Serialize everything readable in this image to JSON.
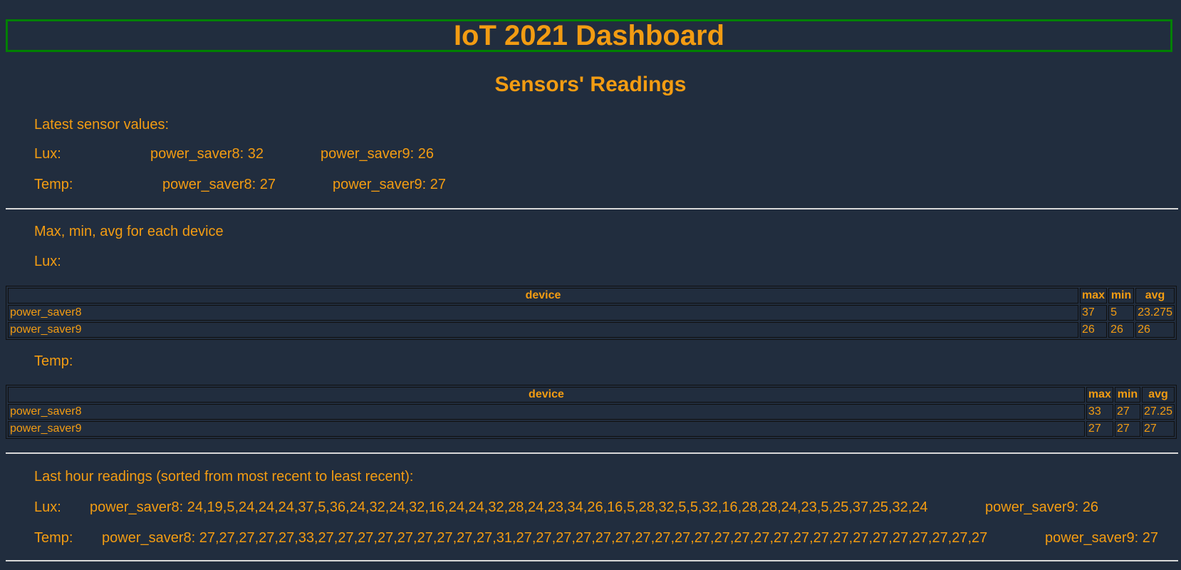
{
  "header": {
    "title": "IoT 2021 Dashboard",
    "subtitle": "Sensors' Readings"
  },
  "latest": {
    "heading": "Latest sensor values:",
    "lux": {
      "label": "Lux:",
      "values": [
        "power_saver8: 32",
        "power_saver9: 26"
      ]
    },
    "temp": {
      "label": "Temp:",
      "values": [
        "power_saver8: 27",
        "power_saver9: 27"
      ]
    }
  },
  "stats": {
    "heading": "Max, min, avg for each device",
    "lux": {
      "label": "Lux:",
      "columns": [
        "device",
        "max",
        "min",
        "avg"
      ],
      "rows": [
        [
          "power_saver8",
          "37",
          "5",
          "23.275"
        ],
        [
          "power_saver9",
          "26",
          "26",
          "26"
        ]
      ]
    },
    "temp": {
      "label": "Temp:",
      "columns": [
        "device",
        "max",
        "min",
        "avg"
      ],
      "rows": [
        [
          "power_saver8",
          "33",
          "27",
          "27.25"
        ],
        [
          "power_saver9",
          "27",
          "27",
          "27"
        ]
      ]
    }
  },
  "last_hour": {
    "heading": "Last hour readings (sorted from most recent to least recent):",
    "lux": {
      "label": "Lux:",
      "values": [
        "power_saver8: 24,19,5,24,24,24,37,5,36,24,32,24,32,16,24,24,32,28,24,23,34,26,16,5,28,32,5,5,32,16,28,28,24,23,5,25,37,25,32,24",
        "power_saver9: 26"
      ]
    },
    "temp": {
      "label": "Temp:",
      "values": [
        "power_saver8: 27,27,27,27,27,33,27,27,27,27,27,27,27,27,27,31,27,27,27,27,27,27,27,27,27,27,27,27,27,27,27,27,27,27,27,27,27,27,27,27",
        "power_saver9: 27"
      ]
    }
  },
  "colors": {
    "background": "#212d3e",
    "text": "#f39c12",
    "title_border": "#008000",
    "separator": "#d8d8d8"
  }
}
